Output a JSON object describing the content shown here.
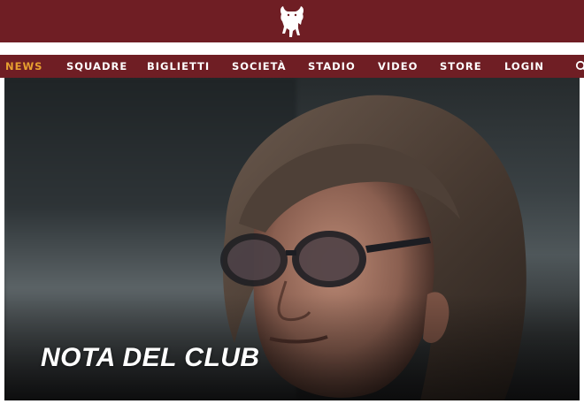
{
  "header": {
    "logo_icon": "bull-logo-icon",
    "bg_color": "#6f1e24"
  },
  "nav": {
    "items": [
      {
        "label": "NEWS",
        "active": true
      },
      {
        "label": "SQUADRE",
        "active": false
      },
      {
        "label": "BIGLIETTI",
        "active": false
      },
      {
        "label": "SOCIETÀ",
        "active": false
      },
      {
        "label": "STADIO",
        "active": false
      },
      {
        "label": "VIDEO",
        "active": false
      },
      {
        "label": "STORE",
        "active": false
      },
      {
        "label": "LOGIN",
        "active": false
      }
    ],
    "search_icon": "search-icon",
    "active_color": "#e7a030"
  },
  "hero": {
    "title": "NOTA DEL CLUB"
  }
}
